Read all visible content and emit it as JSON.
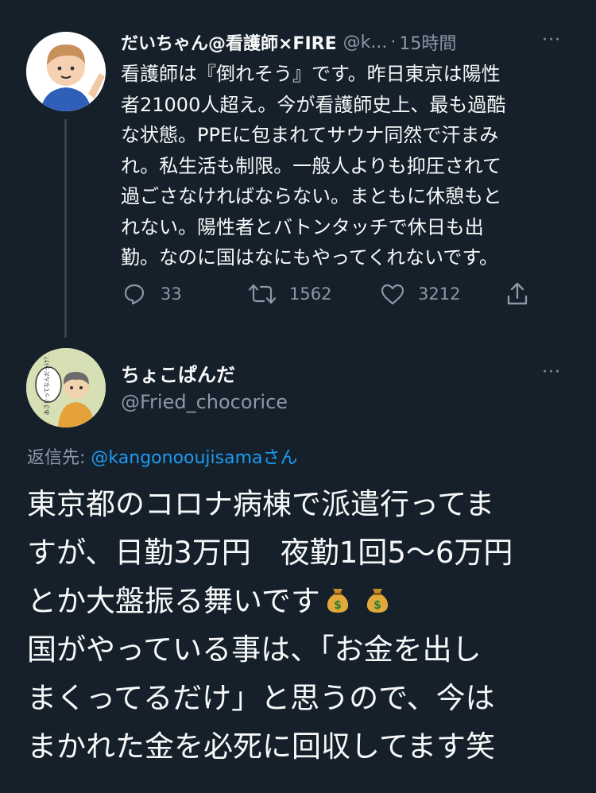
{
  "tweet1": {
    "display_name": "だいちゃん@看護師×FIRE",
    "handle": "@k...",
    "separator": "·",
    "time": "15時間",
    "more": "···",
    "lines": [
      "看護師は『倒れそう』です。昨日東京は陽性",
      "者21000人超え。今が看護師史上、最も過酷",
      "な状態。PPEに包まれてサウナ同然で汗まみ",
      "れ。私生活も制限。一般人よりも抑圧されて",
      "過ごさなければならない。まともに休憩もと",
      "れない。陽性者とバトンタッチで休日も出",
      "勤。なのに国はなにもやってくれないです。"
    ],
    "reply_count": "33",
    "retweet_count": "1562",
    "like_count": "3212",
    "icons": [
      "reply-icon",
      "retweet-icon",
      "like-icon",
      "share-icon"
    ]
  },
  "tweet2": {
    "display_name": "ちょこぱんだ",
    "handle": "@Fried_chocorice",
    "more": "···",
    "avatar_text": "あさりってなんだっけ？",
    "reply_prefix": "返信先:",
    "reply_target": "@kangonooujisama",
    "reply_suffix": "さん",
    "lines": [
      "東京都のコロナ病棟で派遣行ってま",
      "すが、日勤3万円　夜勤1回5～6万円",
      "とか大盤振る舞いです",
      "国がやっている事は、「お金を出し",
      "まくってるだけ」と思うので、今は",
      "まかれた金を必死に回収してます笑"
    ],
    "emoji": [
      "money-bag-icon",
      "money-bag-icon"
    ]
  },
  "colors": {
    "background": "#15202b",
    "text": "#f7f9f9",
    "secondary": "#8b98a5",
    "link": "#1d9bf0"
  }
}
